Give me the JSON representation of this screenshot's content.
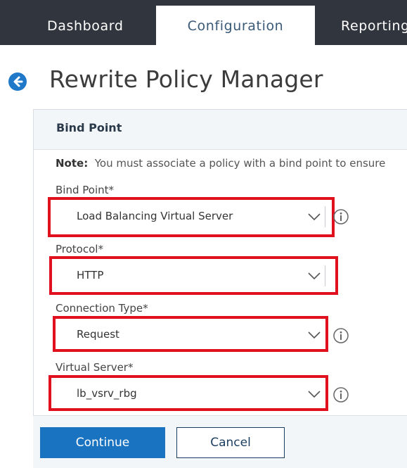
{
  "nav": {
    "tabs": [
      {
        "label": "Dashboard"
      },
      {
        "label": "Configuration"
      },
      {
        "label": "Reporting"
      }
    ]
  },
  "header": {
    "title": "Rewrite Policy Manager"
  },
  "panel": {
    "title": "Bind Point",
    "note_label": "Note:",
    "note_text": "You must associate a policy with a bind point to ensure"
  },
  "fields": {
    "bind_point": {
      "label": "Bind Point*",
      "value": "Load Balancing Virtual Server"
    },
    "protocol": {
      "label": "Protocol*",
      "value": "HTTP"
    },
    "connection_type": {
      "label": "Connection Type*",
      "value": "Request"
    },
    "virtual_server": {
      "label": "Virtual Server*",
      "value": "lb_vsrv_rbg"
    }
  },
  "buttons": {
    "continue": "Continue",
    "cancel": "Cancel"
  },
  "colors": {
    "nav_bg": "#31363e",
    "primary": "#1a73c1",
    "highlight": "#e0101e"
  }
}
